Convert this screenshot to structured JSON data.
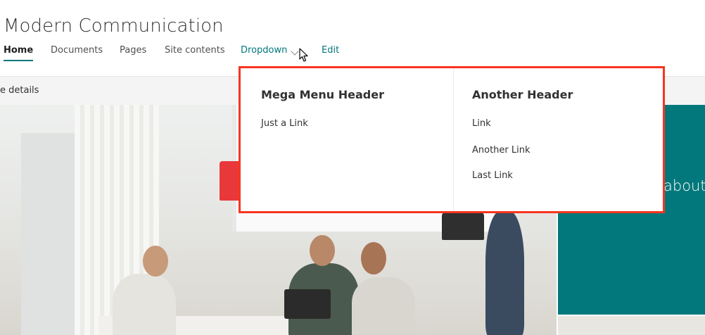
{
  "site": {
    "title": "Modern Communication"
  },
  "nav": {
    "items": [
      {
        "label": "Home",
        "active": true
      },
      {
        "label": "Documents"
      },
      {
        "label": "Pages"
      },
      {
        "label": "Site contents"
      },
      {
        "label": "Dropdown"
      },
      {
        "label": "Edit"
      }
    ]
  },
  "command_bar": {
    "text": "e details"
  },
  "hero": {
    "teal_text": "about"
  },
  "mega_menu": {
    "columns": [
      {
        "header": "Mega Menu Header",
        "links": [
          "Just a Link"
        ]
      },
      {
        "header": "Another Header",
        "links": [
          "Link",
          "Another Link",
          "Last Link"
        ]
      }
    ]
  },
  "colors": {
    "accent": "#03787c",
    "highlight_border": "#f7351f"
  },
  "icons": {
    "dropdown": "chevron-down-icon",
    "cursor": "mouse-pointer-icon"
  }
}
